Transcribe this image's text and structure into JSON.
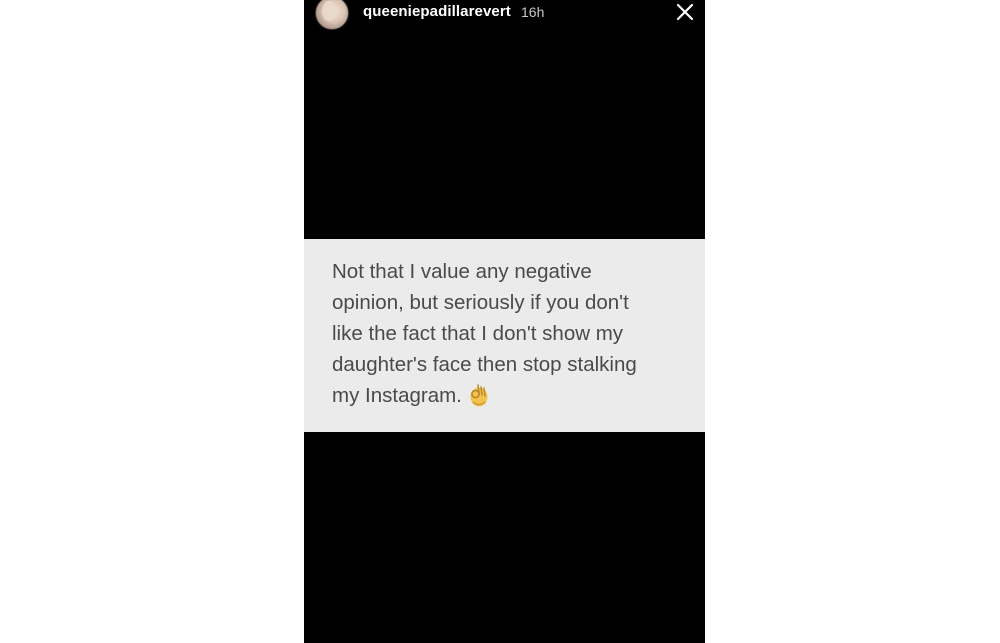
{
  "story": {
    "username": "queeniepadillarevert",
    "timestamp": "16h",
    "close_icon": "close-icon",
    "avatar_icon": "profile-avatar",
    "note": {
      "lines": [
        "Not that I value any negative",
        "opinion, but seriously if you don't",
        "like the fact that I don't show my",
        "daughter's face then stop stalking",
        "my Instagram."
      ],
      "emoji": "ok-hand-icon"
    },
    "colors": {
      "story_background": "#000000",
      "note_background": "#ebebeb",
      "note_text": "#4a4a4a",
      "username_text": "#ffffff"
    }
  }
}
